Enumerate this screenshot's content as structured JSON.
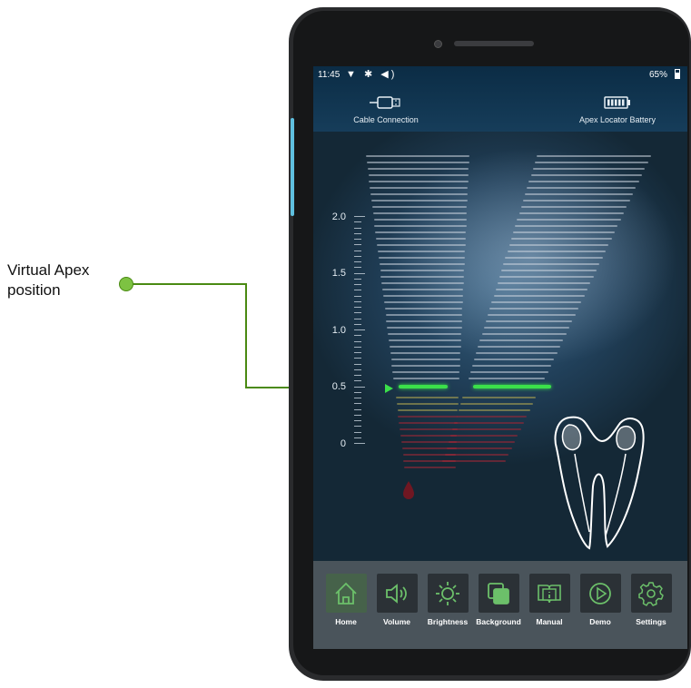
{
  "callout": {
    "label_line1": "Virtual Apex",
    "label_line2": "position"
  },
  "status_bar": {
    "time": "11:45",
    "battery_pct": "65%"
  },
  "header": {
    "cable_label": "Cable Connection",
    "battery_label": "Apex Locator Battery"
  },
  "scale": {
    "labels": [
      "2.0",
      "1.5",
      "1.0",
      "0.5",
      "0"
    ]
  },
  "toolbar": {
    "items": [
      {
        "label": "Home",
        "icon": "home-icon"
      },
      {
        "label": "Volume",
        "icon": "volume-icon"
      },
      {
        "label": "Brightness",
        "icon": "brightness-icon"
      },
      {
        "label": "Background",
        "icon": "background-icon"
      },
      {
        "label": "Manual",
        "icon": "manual-icon"
      },
      {
        "label": "Demo",
        "icon": "play-icon"
      },
      {
        "label": "Settings",
        "icon": "gear-icon"
      }
    ]
  },
  "colors": {
    "accent_green": "#3be04a",
    "callout_green": "#7dc242",
    "toolbar_bg": "#4a545b"
  }
}
